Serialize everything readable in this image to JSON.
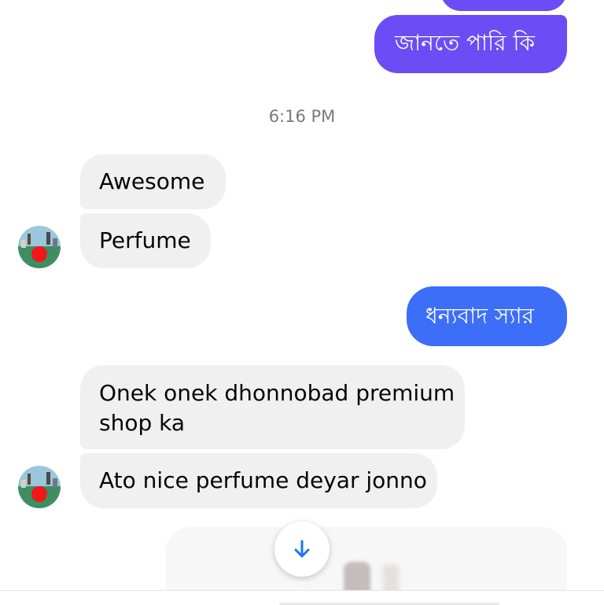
{
  "colors": {
    "outgoing_purple": "#6a4df4",
    "outgoing_blue": "#3d6ef8",
    "incoming_bg": "#f0f0f0",
    "timestamp": "#7a7a7a",
    "scroll_arrow": "#1877f2"
  },
  "conversation": {
    "messages_top": [
      {
        "text": "জানতে পারি কি",
        "direction": "outgoing"
      }
    ],
    "timestamp": "6:16 PM",
    "group_1": [
      {
        "text": "Awesome",
        "direction": "incoming"
      },
      {
        "text": "Perfume",
        "direction": "incoming"
      }
    ],
    "reply": {
      "text": "ধন্যবাদ স্যার",
      "direction": "outgoing"
    },
    "group_2": [
      {
        "line1": "Onek onek dhonnobad premium",
        "line2": "shop ka",
        "direction": "incoming"
      },
      {
        "text": "Ato nice perfume deyar jonno",
        "direction": "incoming"
      }
    ]
  },
  "icons": {
    "scroll_down": "arrow-down-icon",
    "avatar": "contact-avatar"
  }
}
